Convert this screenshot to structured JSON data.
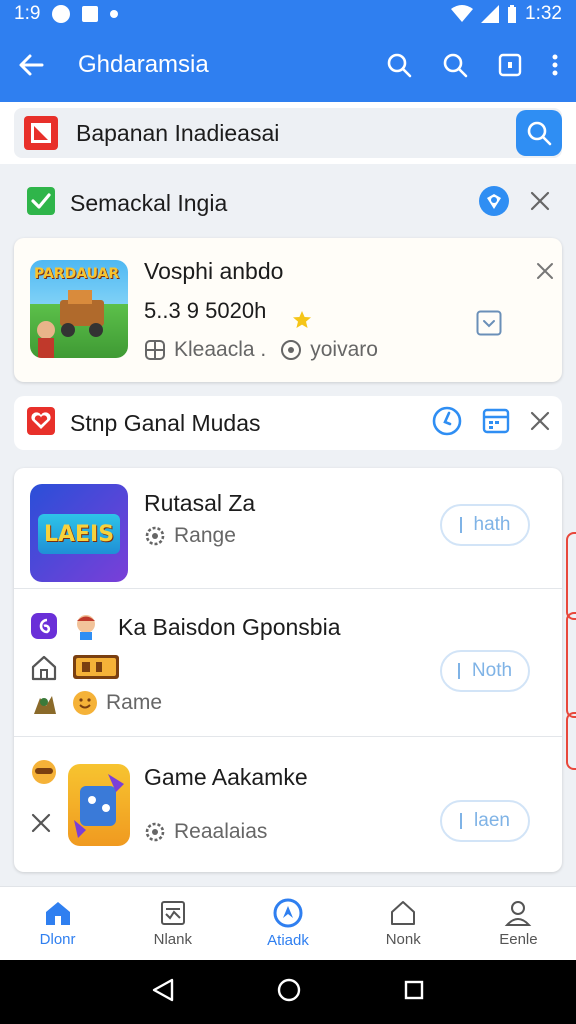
{
  "status_bar": {
    "time_left": "1:9",
    "time_right": "1:32"
  },
  "app_bar": {
    "title": "Ghdaramsia"
  },
  "search": {
    "value": "Bapanan Inadieasai"
  },
  "section1": {
    "label": "Semackal Ingia"
  },
  "game1": {
    "title": "Vosphi anbdo",
    "rating_text": "5..3  9 5020h",
    "meta1": "Kleaacla .",
    "meta2": "yoivaro",
    "thumb_text": "PARDAUAR"
  },
  "section2": {
    "label": "Stnp Ganal Mudas"
  },
  "games": [
    {
      "title": "Rutasal Za",
      "meta": "Range",
      "button": "hath",
      "thumb_text": "LAEIS"
    },
    {
      "title": "Ka   Baisdon Gponsbia",
      "meta": "Rame",
      "button": "Noth"
    },
    {
      "title": "Game Aakamke",
      "meta": "Reaalaias",
      "button": "laen"
    }
  ],
  "bottom_nav": [
    {
      "label": "Dlonr"
    },
    {
      "label": "Nlank"
    },
    {
      "label": "Atiadk"
    },
    {
      "label": "Nonk"
    },
    {
      "label": "Eenle"
    }
  ],
  "colors": {
    "primary": "#2f7ff0",
    "accent_red": "#e8302a",
    "star": "#f5c518",
    "green": "#2fb54a"
  }
}
